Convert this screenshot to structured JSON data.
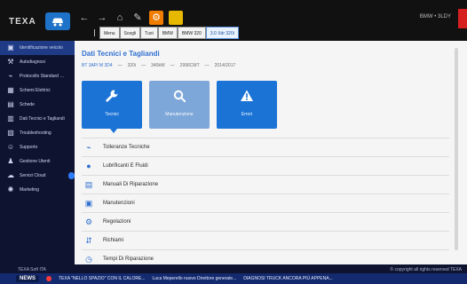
{
  "brand": {
    "name": "TEXA"
  },
  "top": {
    "tabs": [
      "Menu",
      "Scegli",
      "Tuoi",
      "BMW",
      "BMW 320",
      "3.0 Xdr 320i"
    ],
    "right_status": "BMW • 3LDY"
  },
  "sidebar": {
    "items": [
      {
        "label": "Identificazione veicolo",
        "icon": "car-icon",
        "selected": true
      },
      {
        "label": "Autodiagnosi",
        "icon": "wrench-icon"
      },
      {
        "label": "Protocollo Standard OBD",
        "icon": "plug-icon"
      },
      {
        "label": "Schemi Elettrici",
        "icon": "schematic-icon"
      },
      {
        "label": "Schede",
        "icon": "cards-icon"
      },
      {
        "label": "Dati Tecnici e Tagliandi",
        "icon": "book-icon"
      },
      {
        "label": "Troubleshooting",
        "icon": "clipboard-icon"
      },
      {
        "label": "Supporto",
        "icon": "support-icon"
      },
      {
        "label": "Gestione Utenti",
        "icon": "users-icon"
      },
      {
        "label": "Servizi Cloud",
        "icon": "cloud-icon",
        "pill": true
      },
      {
        "label": "Marketing",
        "icon": "bulb-icon"
      }
    ]
  },
  "main": {
    "title": "Dati Tecnici e Tagliandi",
    "breadcrumb": [
      "BT 3AP/ M 3D4",
      "320i",
      "340kW",
      "2996CMT",
      "2014/2017"
    ],
    "tiles": [
      {
        "label": "Tecnici",
        "icon": "wrench-icon",
        "active": true
      },
      {
        "label": "Manutenzione",
        "icon": "search-icon"
      },
      {
        "label": "Errori",
        "icon": "warning-icon"
      }
    ],
    "list": [
      {
        "label": "Tolleranze Tecniche",
        "icon": "gauge-icon"
      },
      {
        "label": "Lubrificanti E Fluidi",
        "icon": "droplet-icon"
      },
      {
        "label": "Manuali Di Riparazione",
        "icon": "manual-icon"
      },
      {
        "label": "Manutenzioni",
        "icon": "service-icon"
      },
      {
        "label": "Regolazioni",
        "icon": "adjust-icon"
      },
      {
        "label": "Richiami",
        "icon": "recall-icon"
      },
      {
        "label": "Tempi Di Riparazione",
        "icon": "clock-icon"
      }
    ]
  },
  "footer": {
    "left_status": "TEXA Soft ITA",
    "right_status": "© copyright all rights reserved TEXA",
    "news_tag": "NEWS",
    "news_items": [
      "TEXA \"NELLO SPAZIO\" CON IL CALORE...",
      "Luca Meperello nuovo Direttore generale...",
      "DIAGNOSI TRUCK ANCORA PIÙ APPENA..."
    ]
  }
}
